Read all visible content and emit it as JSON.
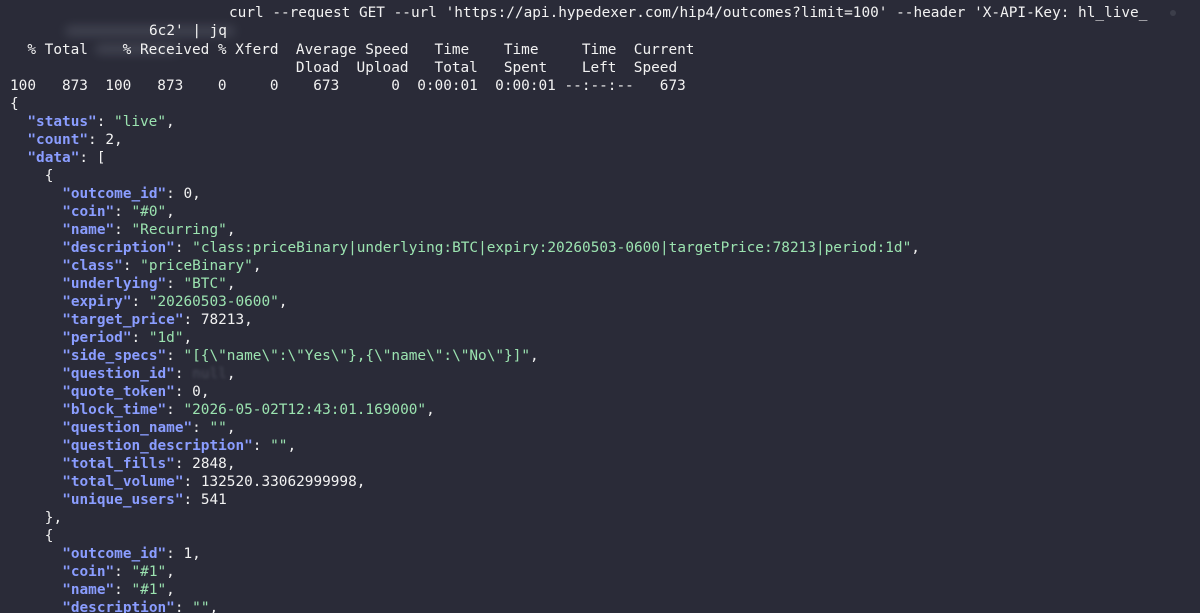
{
  "terminal": {
    "command_line1": "curl --request GET --url 'https://api.hypedexer.com/hip4/outcomes?limit=100' --header 'X-API-Key: hl_live_",
    "command_line2": "6c2' | jq",
    "progress_header1": "  % Total    % Received % Xferd  Average Speed   Time    Time     Time  Current",
    "progress_header2": "                                 Dload  Upload   Total   Spent    Left  Speed",
    "progress_values": "100   873  100   873    0     0    673      0  0:00:01  0:00:01 --:--:--   673"
  },
  "response": {
    "status_key": "\"status\"",
    "status_value": "\"live\"",
    "count_key": "\"count\"",
    "count_value": "2",
    "data_key": "\"data\"",
    "items": [
      {
        "fields": [
          {
            "key": "\"outcome_id\"",
            "value": "0",
            "type": "num"
          },
          {
            "key": "\"coin\"",
            "value": "\"#0\"",
            "type": "str"
          },
          {
            "key": "\"name\"",
            "value": "\"Recurring\"",
            "type": "str"
          },
          {
            "key": "\"description\"",
            "value": "\"class:priceBinary|underlying:BTC|expiry:20260503-0600|targetPrice:78213|period:1d\"",
            "type": "str"
          },
          {
            "key": "\"class\"",
            "value": "\"priceBinary\"",
            "type": "str"
          },
          {
            "key": "\"underlying\"",
            "value": "\"BTC\"",
            "type": "str"
          },
          {
            "key": "\"expiry\"",
            "value": "\"20260503-0600\"",
            "type": "str"
          },
          {
            "key": "\"target_price\"",
            "value": "78213",
            "type": "num"
          },
          {
            "key": "\"period\"",
            "value": "\"1d\"",
            "type": "str"
          },
          {
            "key": "\"side_specs\"",
            "value": "\"[{\\\"name\\\":\\\"Yes\\\"},{\\\"name\\\":\\\"No\\\"}]\"",
            "type": "str"
          },
          {
            "key": "\"question_id\"",
            "value": "null",
            "type": "null"
          },
          {
            "key": "\"quote_token\"",
            "value": "0",
            "type": "num"
          },
          {
            "key": "\"block_time\"",
            "value": "\"2026-05-02T12:43:01.169000\"",
            "type": "str"
          },
          {
            "key": "\"question_name\"",
            "value": "\"\"",
            "type": "str"
          },
          {
            "key": "\"question_description\"",
            "value": "\"\"",
            "type": "str"
          },
          {
            "key": "\"total_fills\"",
            "value": "2848",
            "type": "num"
          },
          {
            "key": "\"total_volume\"",
            "value": "132520.33062999998",
            "type": "num"
          },
          {
            "key": "\"unique_users\"",
            "value": "541",
            "type": "num",
            "last": true
          }
        ]
      },
      {
        "fields": [
          {
            "key": "\"outcome_id\"",
            "value": "1",
            "type": "num"
          },
          {
            "key": "\"coin\"",
            "value": "\"#1\"",
            "type": "str"
          },
          {
            "key": "\"name\"",
            "value": "\"#1\"",
            "type": "str"
          },
          {
            "key": "\"description\"",
            "value": "\"\"",
            "type": "str"
          }
        ]
      }
    ]
  },
  "colors": {
    "background": "#2a2b38",
    "key": "#8a9dff",
    "string": "#9be3b0",
    "plain": "#f2f2f2"
  }
}
